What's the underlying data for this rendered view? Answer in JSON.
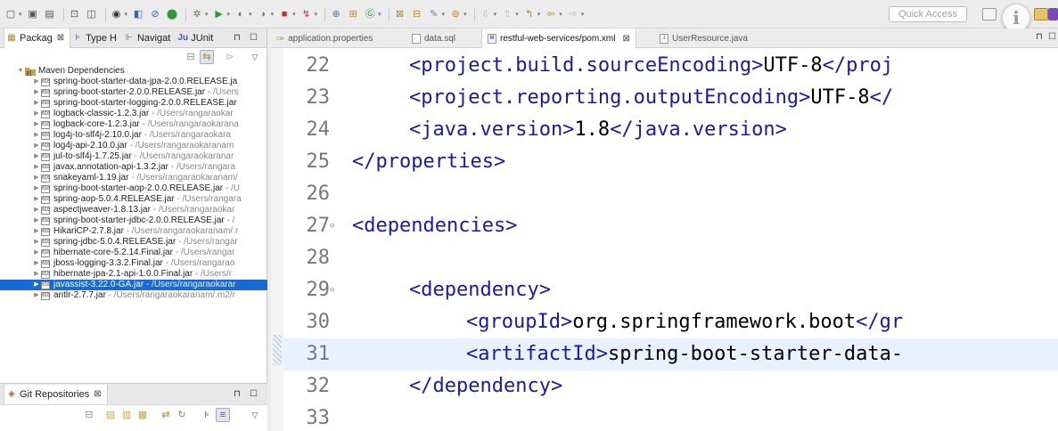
{
  "toolbar": {
    "quick_access": "Quick Access"
  },
  "left_panel": {
    "tabs": [
      {
        "label": "Packag",
        "close": "⊠"
      },
      {
        "label": "Type H"
      },
      {
        "label": "Navigat"
      },
      {
        "label": "JUnit"
      }
    ],
    "tree_root": "Maven Dependencies",
    "jars": [
      {
        "name": "spring-boot-starter-data-jpa-2.0.0.RELEASE.ja",
        "path": ""
      },
      {
        "name": "spring-boot-starter-2.0.0.RELEASE.jar",
        "path": " - /Users"
      },
      {
        "name": "spring-boot-starter-logging-2.0.0.RELEASE.jar",
        "path": ""
      },
      {
        "name": "logback-classic-1.2.3.jar",
        "path": " - /Users/rangaraokar"
      },
      {
        "name": "logback-core-1.2.3.jar",
        "path": " - /Users/rangaraokarana"
      },
      {
        "name": "log4j-to-slf4j-2.10.0.jar",
        "path": " - /Users/rangaraokara"
      },
      {
        "name": "log4j-api-2.10.0.jar",
        "path": " - /Users/rangaraokaranam"
      },
      {
        "name": "jul-to-slf4j-1.7.25.jar",
        "path": " - /Users/rangaraokaranar"
      },
      {
        "name": "javax.annotation-api-1.3.2.jar",
        "path": " - /Users/rangara"
      },
      {
        "name": "snakeyaml-1.19.jar",
        "path": " - /Users/rangaraokaranam/"
      },
      {
        "name": "spring-boot-starter-aop-2.0.0.RELEASE.jar",
        "path": " - /U"
      },
      {
        "name": "spring-aop-5.0.4.RELEASE.jar",
        "path": " - /Users/rangara"
      },
      {
        "name": "aspectjweaver-1.8.13.jar",
        "path": " - /Users/rangaraokar"
      },
      {
        "name": "spring-boot-starter-jdbc-2.0.0.RELEASE.jar",
        "path": " - /"
      },
      {
        "name": "HikariCP-2.7.8.jar",
        "path": " - /Users/rangaraokaranam/.r"
      },
      {
        "name": "spring-jdbc-5.0.4.RELEASE.jar",
        "path": " - /Users/rangar"
      },
      {
        "name": "hibernate-core-5.2.14.Final.jar",
        "path": " - /Users/rangar"
      },
      {
        "name": "jboss-logging-3.3.2.Final.jar",
        "path": " - /Users/rangarao"
      },
      {
        "name": "hibernate-jpa-2.1-api-1.0.0.Final.jar",
        "path": " - /Users/r"
      },
      {
        "name": "javassist-3.22.0-GA.jar",
        "path": " - /Users/rangaraokarar"
      },
      {
        "name": "antlr-2.7.7.jar",
        "path": " - /Users/rangaraokaranam/.m2/r"
      }
    ],
    "git_tab_label": "Git Repositories",
    "git_close": "⊠"
  },
  "editor": {
    "tabs": [
      {
        "label": "application.properties"
      },
      {
        "label": "data.sql"
      },
      {
        "label": "restful-web-services/pom.xml",
        "close": "⊠"
      },
      {
        "label": "UserResource.java"
      }
    ],
    "lines": [
      {
        "num": "22",
        "fold": "",
        "parts": [
          [
            "tag",
            "<project.build.sourceEncoding>"
          ],
          [
            "txt",
            "UTF-8"
          ],
          [
            "tag",
            "</proj"
          ]
        ]
      },
      {
        "num": "23",
        "fold": "",
        "parts": [
          [
            "tag",
            "<project.reporting.outputEncoding>"
          ],
          [
            "txt",
            "UTF-8"
          ],
          [
            "tag",
            "</"
          ]
        ]
      },
      {
        "num": "24",
        "fold": "",
        "parts": [
          [
            "tag",
            "<java.version>"
          ],
          [
            "txt",
            "1.8"
          ],
          [
            "tag",
            "</java.version>"
          ]
        ]
      },
      {
        "num": "25",
        "fold": "",
        "parts": [
          [
            "tag",
            "</properties>"
          ]
        ]
      },
      {
        "num": "26",
        "fold": "",
        "parts": []
      },
      {
        "num": "27",
        "fold": "⊖",
        "parts": [
          [
            "tag",
            "<dependencies>"
          ]
        ]
      },
      {
        "num": "28",
        "fold": "",
        "parts": []
      },
      {
        "num": "29",
        "fold": "⊖",
        "parts": [
          [
            "tag",
            "<dependency>"
          ]
        ]
      },
      {
        "num": "30",
        "fold": "",
        "parts": [
          [
            "tag",
            "<groupId>"
          ],
          [
            "txt",
            "org.springframework.boot"
          ],
          [
            "tag",
            "</gr"
          ]
        ]
      },
      {
        "num": "31",
        "fold": "",
        "parts": [
          [
            "tag",
            "<artifactId>"
          ],
          [
            "txt",
            "spring-boot-starter-data-"
          ]
        ]
      },
      {
        "num": "32",
        "fold": "",
        "parts": [
          [
            "tag",
            "</dependency>"
          ]
        ]
      },
      {
        "num": "33",
        "fold": "",
        "parts": []
      }
    ]
  }
}
